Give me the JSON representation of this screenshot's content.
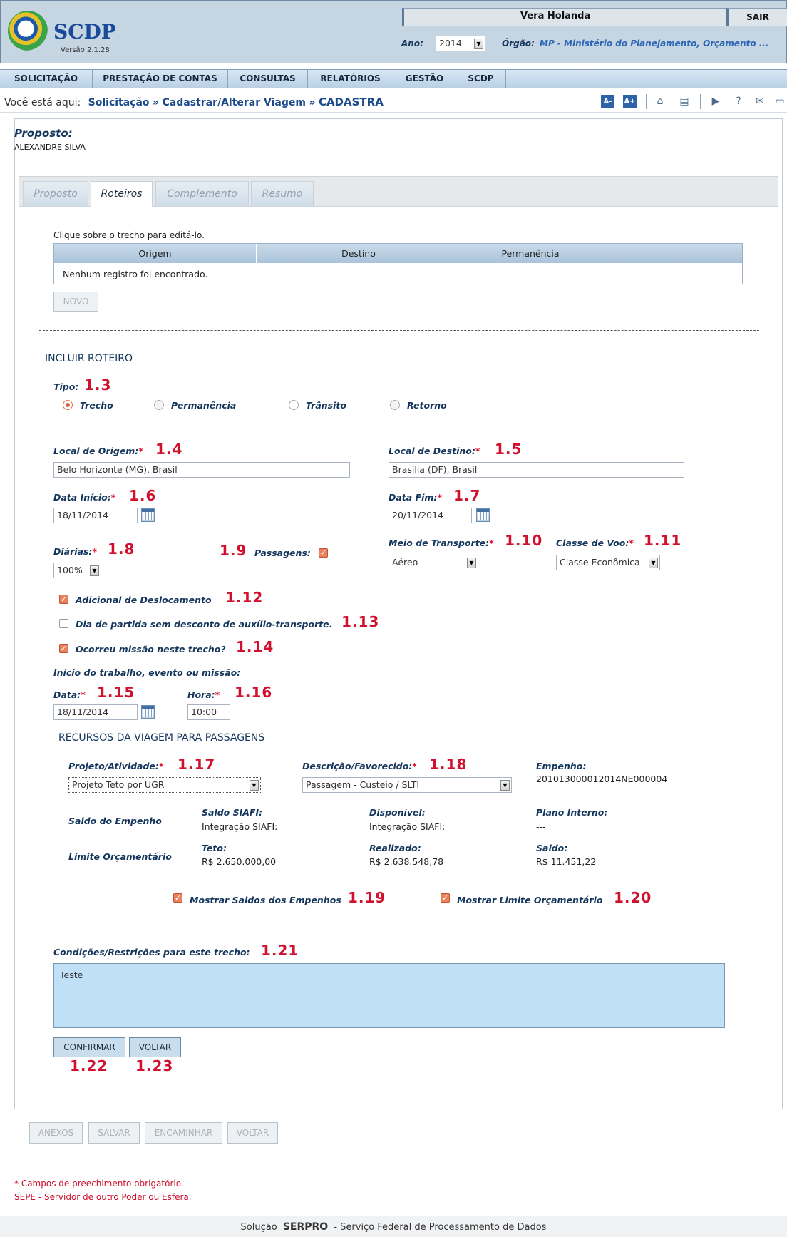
{
  "header": {
    "logo_text": "SCDP",
    "version": "Versão 2.1.28",
    "user_name": "Vera Holanda",
    "logout": "SAIR",
    "ano_label": "Ano:",
    "ano_value": "2014",
    "orgao_label": "Órgão:",
    "orgao_value": "MP - Ministério do Planejamento, Orçamento ..."
  },
  "menu": [
    "SOLICITAÇÃO",
    "PRESTAÇÃO DE CONTAS",
    "CONSULTAS",
    "RELATÓRIOS",
    "GESTÃO",
    "SCDP"
  ],
  "breadcrumb": {
    "prefix": "Você está aqui:",
    "items": [
      "Solicitação",
      "Cadastrar/Alterar Viagem",
      "CADASTRA"
    ]
  },
  "toolbar_icons": [
    "font-decrease-icon",
    "font-increase-icon",
    "home-icon",
    "messages-icon",
    "video-icon",
    "help-icon",
    "mail-icon",
    "chat-icon"
  ],
  "font_buttons": {
    "minus": "A-",
    "plus": "A+"
  },
  "proposto": {
    "label": "Proposto:",
    "name": "ALEXANDRE SILVA"
  },
  "tabs": [
    "Proposto",
    "Roteiros",
    "Complemento",
    "Resumo"
  ],
  "roteiros_table": {
    "hint": "Clique sobre o trecho para editá-lo.",
    "columns": [
      "Origem",
      "Destino",
      "Permanência"
    ],
    "empty": "Nenhum registro foi encontrado.",
    "new_button": "NOVO"
  },
  "incluir": {
    "title": "INCLUIR ROTEIRO",
    "tipo_label": "Tipo:",
    "tipo_options": [
      "Trecho",
      "Permanência",
      "Trânsito",
      "Retorno"
    ],
    "tipo_selected": "Trecho",
    "origem_label": "Local de Origem:",
    "origem_value": "Belo Horizonte (MG), Brasil",
    "destino_label": "Local de Destino:",
    "destino_value": "Brasília (DF), Brasil",
    "data_inicio_label": "Data Início:",
    "data_inicio_value": "18/11/2014",
    "data_fim_label": "Data Fim:",
    "data_fim_value": "20/11/2014",
    "diarias_label": "Diárias:",
    "diarias_value": "100%",
    "passagens_label": "Passagens:",
    "meio_label": "Meio de Transporte:",
    "meio_value": "Aéreo",
    "classe_label": "Classe de Voo:",
    "classe_value": "Classe Econômica",
    "adicional_label": "Adicional de Deslocamento",
    "dia_partida_label": "Dia de partida sem desconto de auxílio-transporte.",
    "missao_label": "Ocorreu missão neste trecho?",
    "inicio_trabalho_label": "Início do trabalho, evento ou missão:",
    "data_label": "Data:",
    "data_value": "18/11/2014",
    "hora_label": "Hora:",
    "hora_value": "10:00",
    "required_mark": "*"
  },
  "recursos": {
    "title": "RECURSOS DA VIAGEM PARA PASSAGENS",
    "projeto_label": "Projeto/Atividade:",
    "projeto_value": "Projeto Teto por UGR",
    "descricao_label": "Descrição/Favorecido:",
    "descricao_value": "Passagem - Custeio / SLTI",
    "empenho_label": "Empenho:",
    "empenho_value": "201013000012014NE000004",
    "saldo_empenho": "Saldo do Empenho",
    "saldo_siafi_label": "Saldo SIAFI:",
    "saldo_siafi_value": "Integração SIAFI:",
    "disponivel_label": "Disponível:",
    "disponivel_value": "Integração SIAFI:",
    "plano_label": "Plano Interno:",
    "plano_value": "---",
    "limite": "Limite Orçamentário",
    "teto_label": "Teto:",
    "teto_value": "R$ 2.650.000,00",
    "realizado_label": "Realizado:",
    "realizado_value": "R$ 2.638.548,78",
    "saldo_label": "Saldo:",
    "saldo_value": "R$ 11.451,22",
    "mostrar_saldos": "Mostrar Saldos dos Empenhos",
    "mostrar_limite": "Mostrar Limite Orçamentário"
  },
  "condicoes": {
    "label": "Condições/Restrições para este trecho:",
    "value": "Teste"
  },
  "form_buttons": {
    "confirmar": "CONFIRMAR",
    "voltar": "VOLTAR"
  },
  "bottom_buttons": [
    "ANEXOS",
    "SALVAR",
    "ENCAMINHAR",
    "VOLTAR"
  ],
  "notes": {
    "required": "* Campos de preechimento obrigatório.",
    "sepe": "SEPE - Servidor de outro Poder ou Esfera."
  },
  "footer": {
    "prefix": "Solução",
    "brand": "SERPRO",
    "suffix": "- Serviço Federal de Processamento de Dados"
  },
  "annotations": [
    "1.3",
    "1.4",
    "1.5",
    "1.6",
    "1.7",
    "1.8",
    "1.9",
    "1.10",
    "1.11",
    "1.12",
    "1.13",
    "1.14",
    "1.15",
    "1.16",
    "1.17",
    "1.18",
    "1.19",
    "1.20",
    "1.21",
    "1.22",
    "1.23"
  ],
  "colors": {
    "header_bg": "#c6d5e2",
    "menu_bg": "#c8dbec",
    "accent_red": "#d0102c",
    "label_blue": "#14365c",
    "textarea_bg": "#bfe0f7"
  }
}
